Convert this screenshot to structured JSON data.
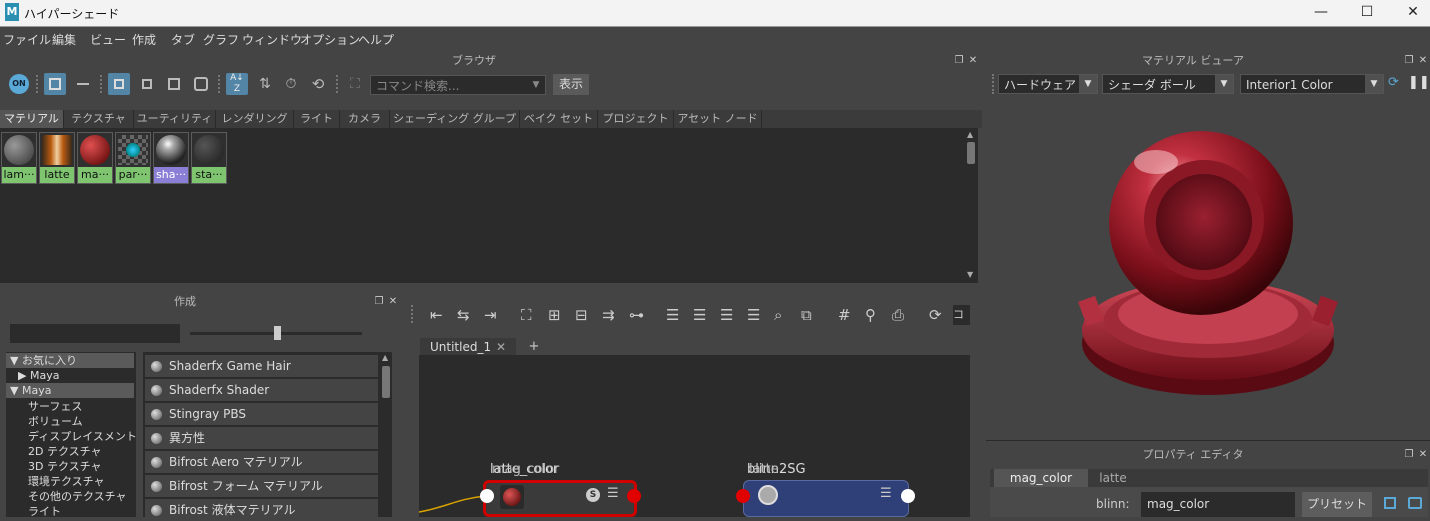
{
  "window": {
    "title": "ハイパーシェード",
    "logo": "M",
    "minimize": "—",
    "maximize": "☐",
    "close": "✕"
  },
  "menu": [
    "ファイル",
    "編集",
    "ビュー",
    "作成",
    "タブ",
    "グラフ",
    "ウィンドウ",
    "オプション",
    "ヘルプ"
  ],
  "browser": {
    "title": "ブラウザ",
    "on_label": "ON",
    "search_placeholder": "コマンド検索...",
    "show_button": "表示",
    "tabs": [
      "マテリアル",
      "テクスチャ",
      "ユーティリティ",
      "レンダリング",
      "ライト",
      "カメラ",
      "シェーディング グループ",
      "ベイク セット",
      "プロジェクト",
      "アセット ノード"
    ],
    "swatches": [
      {
        "label": "lam···"
      },
      {
        "label": "latte"
      },
      {
        "label": "ma···"
      },
      {
        "label": "par···"
      },
      {
        "label": "sha···"
      },
      {
        "label": "sta···"
      }
    ]
  },
  "create": {
    "title": "作成",
    "tree": [
      {
        "label": "▼ お気に入り",
        "indent": 0,
        "selected": true
      },
      {
        "label": "▶ Maya",
        "indent": 1,
        "selected": false
      },
      {
        "label": "▼ Maya",
        "indent": 0,
        "selected": true
      },
      {
        "label": "サーフェス",
        "indent": 2,
        "selected": false
      },
      {
        "label": "ボリューム",
        "indent": 2,
        "selected": false
      },
      {
        "label": "ディスプレイスメント",
        "indent": 2,
        "selected": false
      },
      {
        "label": "2D テクスチャ",
        "indent": 2,
        "selected": false
      },
      {
        "label": "3D テクスチャ",
        "indent": 2,
        "selected": false
      },
      {
        "label": "環境テクスチャ",
        "indent": 2,
        "selected": false
      },
      {
        "label": "その他のテクスチャ",
        "indent": 2,
        "selected": false
      },
      {
        "label": "ライト",
        "indent": 2,
        "selected": false
      }
    ],
    "nodes": [
      "Shaderfx Game Hair",
      "Shaderfx Shader",
      "Stingray PBS",
      "異方性",
      "Bifrost Aero マテリアル",
      "Bifrost フォーム マテリアル",
      "Bifrost 液体マテリアル"
    ]
  },
  "graph": {
    "tab_label": "Untitled_1",
    "tab_close": "✕",
    "add_tab": "+",
    "command_partial": "コマ",
    "node1_label": "latte_color",
    "node1_label_overlap": "mag_color",
    "node2_label": "blinn2SG",
    "node2_label_overlap": "latte",
    "s_badge": "S"
  },
  "material_viewer": {
    "title": "マテリアル ビューア",
    "renderer": "ハードウェア",
    "shape": "シェーダ ボール",
    "environment": "Interior1 Color"
  },
  "property_editor": {
    "title": "プロパティ エディタ",
    "tabs": [
      "mag_color",
      "latte"
    ],
    "field_label": "blinn:",
    "field_value": "mag_color",
    "preset_button": "プリセット"
  },
  "colors": {
    "accent": "#5285a6",
    "swatch_label": "#7fc46f",
    "swatch_selected": "#8a7fd6",
    "node_red": "#d10000",
    "node_blue": "#2f3f78"
  }
}
